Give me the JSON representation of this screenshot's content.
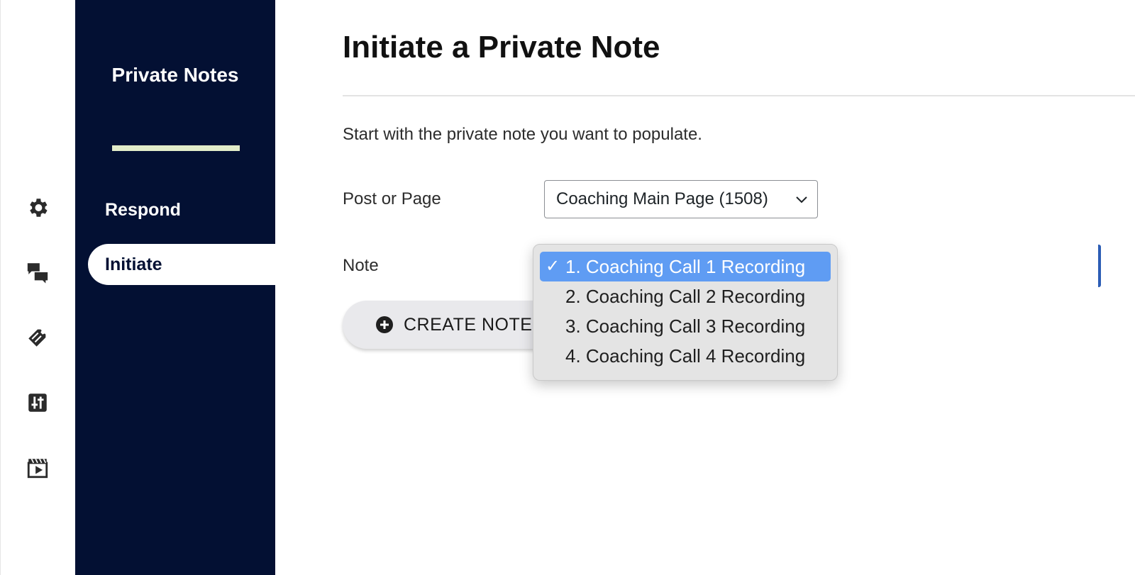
{
  "sidebar": {
    "title": "Private Notes",
    "nav": [
      {
        "label": "Respond"
      },
      {
        "label": "Initiate"
      }
    ]
  },
  "rail_icons": [
    "gear-icon",
    "chat-bubbles-icon",
    "ticket-icon",
    "sliders-icon",
    "video-clapper-icon"
  ],
  "main": {
    "title": "Initiate a Private Note",
    "intro": "Start with the private note you want to populate.",
    "post_label": "Post or Page",
    "post_value": "Coaching Main Page (1508)",
    "note_label": "Note",
    "create_button": "CREATE NOTES"
  },
  "dropdown": {
    "check": "✓",
    "options": [
      {
        "label": "1. Coaching Call 1 Recording",
        "selected": true
      },
      {
        "label": "2. Coaching Call 2 Recording",
        "selected": false
      },
      {
        "label": "3. Coaching Call 3 Recording",
        "selected": false
      },
      {
        "label": "4. Coaching Call 4 Recording",
        "selected": false
      }
    ]
  },
  "colors": {
    "sidebar_bg": "#031033",
    "accent_divider": "#e2ecc9",
    "selected_option": "#5f9cf3",
    "select_border_focus": "#2c5db5"
  }
}
